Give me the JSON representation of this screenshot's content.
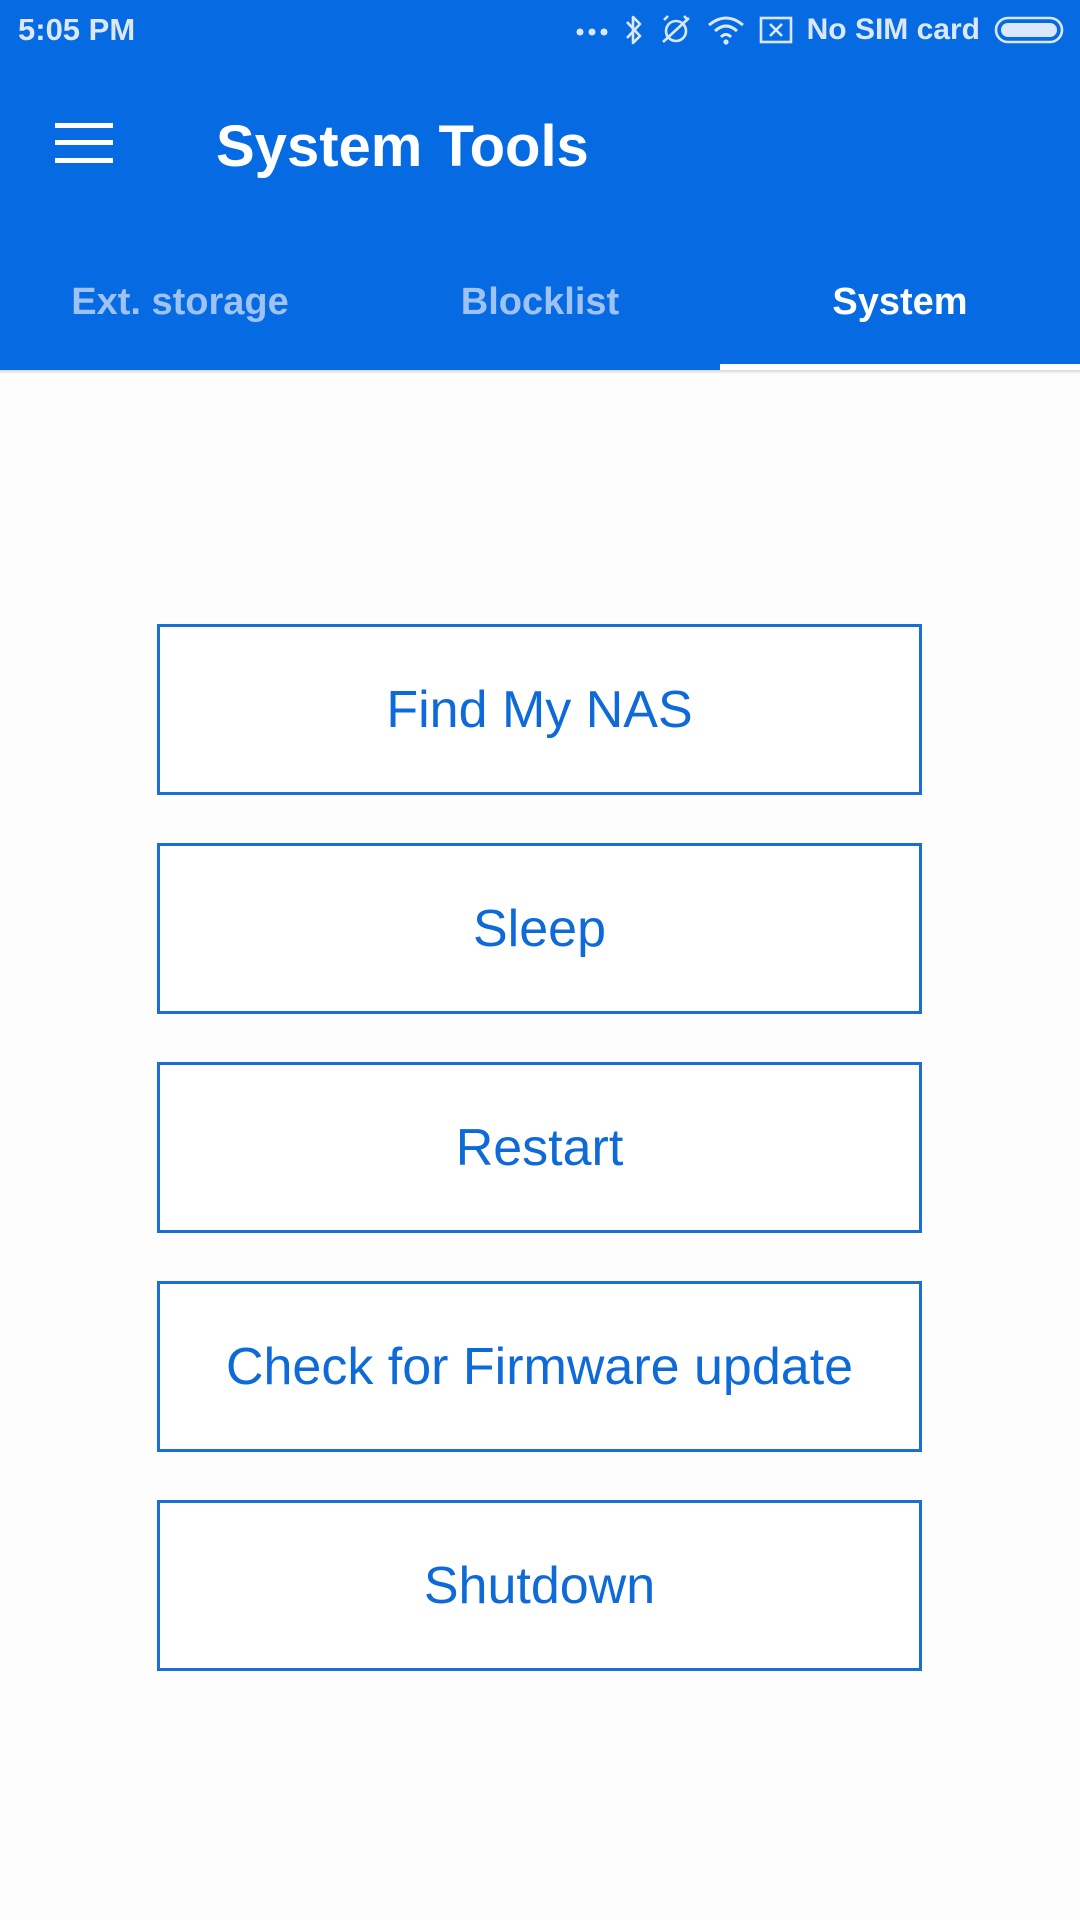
{
  "status_bar": {
    "time": "5:05 PM",
    "carrier": "No SIM card",
    "icons": [
      "more-dots-icon",
      "bluetooth-icon",
      "alarm-off-icon",
      "wifi-icon",
      "no-sim-icon",
      "battery-icon"
    ]
  },
  "app_bar": {
    "title": "System Tools",
    "menu_icon": "hamburger-menu-icon"
  },
  "tabs": [
    {
      "label": "Ext. storage",
      "active": false
    },
    {
      "label": "Blocklist",
      "active": false
    },
    {
      "label": "System",
      "active": true
    }
  ],
  "actions": [
    {
      "label": "Find My NAS"
    },
    {
      "label": "Sleep"
    },
    {
      "label": "Restart"
    },
    {
      "label": "Check for Firmware update"
    },
    {
      "label": "Shutdown"
    }
  ],
  "colors": {
    "primary": "#066ae2",
    "button_text": "#0e6ad8",
    "button_border": "#1a6fd4",
    "background": "#fdfdfd",
    "inactive_tab": "#9ec2f2"
  }
}
